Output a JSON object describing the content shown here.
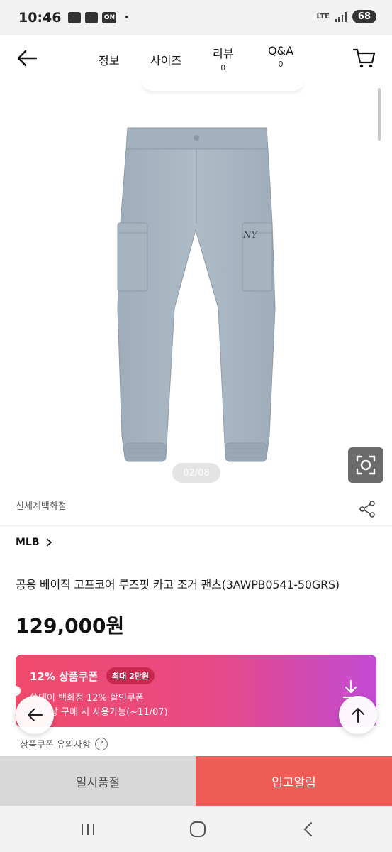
{
  "status_bar": {
    "time": "10:46",
    "on_label": "ON",
    "dot": "•",
    "network": "LTE",
    "battery": "68"
  },
  "header": {
    "tabs": [
      {
        "label": "정보",
        "count": ""
      },
      {
        "label": "사이즈",
        "count": ""
      },
      {
        "label": "리뷰",
        "count": "0"
      },
      {
        "label": "Q&A",
        "count": "0"
      }
    ]
  },
  "gallery": {
    "pager": "02/08",
    "product_color": "#a8b6c2",
    "logo_text": "NY"
  },
  "product": {
    "store": "신세계백화점",
    "brand": "MLB",
    "title": "공용 베이직 고프코어 루즈핏 카고 조거 팬츠(3AWPB0541-50GRS)",
    "price": "129,000원"
  },
  "coupon": {
    "title": "12% 상품쿠폰",
    "badge": "최대 2만원",
    "line1": "쓱데이 백화점 12% 할인쿠폰",
    "line2": "원 이상 구매 시 사용가능(~11/07)"
  },
  "notice": {
    "label": "상품쿠폰 유의사항",
    "icon_text": "?"
  },
  "bottom": {
    "soldout_label": "일시품절",
    "notify_label": "입고알림"
  },
  "colors": {
    "accent": "#ee5c55",
    "coupon_start": "#f04b6b",
    "coupon_end": "#c24bd4"
  }
}
